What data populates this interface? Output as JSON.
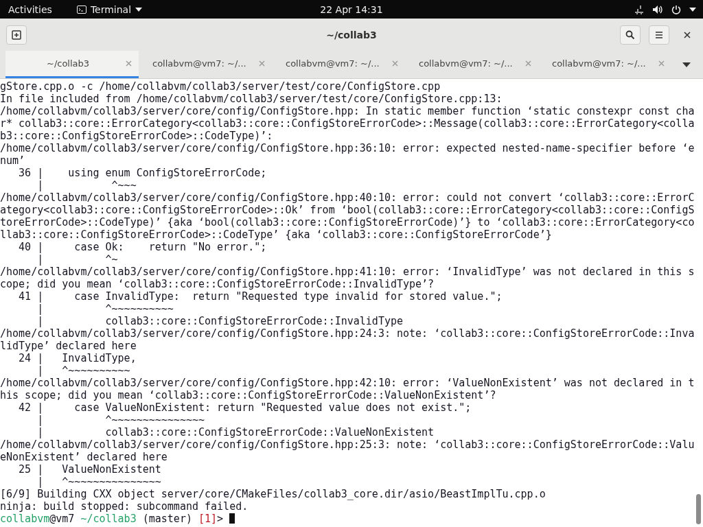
{
  "top_bar": {
    "activities": "Activities",
    "app_menu": "Terminal",
    "clock": "22 Apr  14:31"
  },
  "window": {
    "title": "~/collab3"
  },
  "tabs": [
    {
      "label": "~/collab3",
      "selected": true
    },
    {
      "label": "collabvm@vm7: ~/...",
      "selected": false
    },
    {
      "label": "collabvm@vm7: ~/...",
      "selected": false
    },
    {
      "label": "collabvm@vm7: ~/...",
      "selected": false
    },
    {
      "label": "collabvm@vm7: ~/...",
      "selected": false
    }
  ],
  "terminal": {
    "lines": [
      "gStore.cpp.o -c /home/collabvm/collab3/server/test/core/ConfigStore.cpp",
      "In file included from /home/collabvm/collab3/server/test/core/ConfigStore.cpp:13:",
      "/home/collabvm/collab3/server/core/config/ConfigStore.hpp: In static member function ‘static constexpr const cha",
      "r* collab3::core::ErrorCategory<collab3::core::ConfigStoreErrorCode>::Message(collab3::core::ErrorCategory<colla",
      "b3::core::ConfigStoreErrorCode>::CodeType)’:",
      "/home/collabvm/collab3/server/core/config/ConfigStore.hpp:36:10: error: expected nested-name-specifier before ‘e",
      "num’",
      "   36 |    using enum ConfigStoreErrorCode;",
      "      |           ^~~~",
      "/home/collabvm/collab3/server/core/config/ConfigStore.hpp:40:10: error: could not convert ‘collab3::core::ErrorC",
      "ategory<collab3::core::ConfigStoreErrorCode>::Ok’ from ‘bool(collab3::core::ErrorCategory<collab3::core::ConfigS",
      "toreErrorCode>::CodeType)’ {aka ‘bool(collab3::core::ConfigStoreErrorCode)’} to ‘collab3::core::ErrorCategory<co",
      "llab3::core::ConfigStoreErrorCode>::CodeType’ {aka ‘collab3::core::ConfigStoreErrorCode’}",
      "   40 |     case Ok:    return \"No error.\";",
      "      |          ^~",
      "/home/collabvm/collab3/server/core/config/ConfigStore.hpp:41:10: error: ‘InvalidType’ was not declared in this s",
      "cope; did you mean ‘collab3::core::ConfigStoreErrorCode::InvalidType’?",
      "   41 |     case InvalidType:  return \"Requested type invalid for stored value.\";",
      "      |          ^~~~~~~~~~~",
      "      |          collab3::core::ConfigStoreErrorCode::InvalidType",
      "/home/collabvm/collab3/server/core/config/ConfigStore.hpp:24:3: note: ‘collab3::core::ConfigStoreErrorCode::Inva",
      "lidType’ declared here",
      "   24 |   InvalidType,",
      "      |   ^~~~~~~~~~~",
      "/home/collabvm/collab3/server/core/config/ConfigStore.hpp:42:10: error: ‘ValueNonExistent’ was not declared in t",
      "his scope; did you mean ‘collab3::core::ConfigStoreErrorCode::ValueNonExistent’?",
      "   42 |     case ValueNonExistent: return \"Requested value does not exist.\";",
      "      |          ^~~~~~~~~~~~~~~~",
      "      |          collab3::core::ConfigStoreErrorCode::ValueNonExistent",
      "/home/collabvm/collab3/server/core/config/ConfigStore.hpp:25:3: note: ‘collab3::core::ConfigStoreErrorCode::Valu",
      "eNonExistent’ declared here",
      "   25 |   ValueNonExistent",
      "      |   ^~~~~~~~~~~~~~~~",
      "[6/9] Building CXX object server/core/CMakeFiles/collab3_core.dir/asio/BeastImplTu.cpp.o",
      "ninja: build stopped: subcommand failed."
    ],
    "prompt": {
      "user": "collabvm",
      "host": "@vm7",
      "cwd": "~/collab3",
      "branch": "(master)",
      "status": "[1]",
      "symbol": ">"
    }
  }
}
